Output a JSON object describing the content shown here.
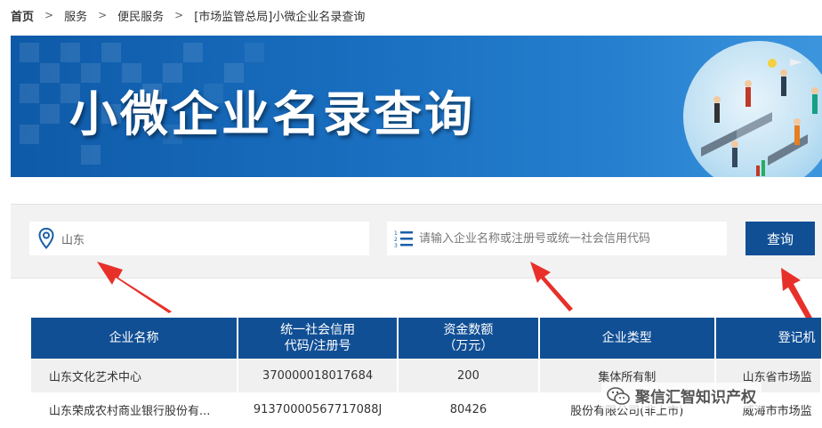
{
  "breadcrumb": {
    "items": [
      "首页",
      "服务",
      "便民服务",
      "[市场监管总局]小微企业名录查询"
    ]
  },
  "banner": {
    "title": "小微企业名录查询"
  },
  "search": {
    "region_value": "山东",
    "keyword_placeholder": "请输入企业名称或注册号或统一社会信用代码",
    "button_label": "查询"
  },
  "table": {
    "headers": [
      "企业名称",
      "统一社会信用代码/注册号",
      "资金数额（万元）",
      "企业类型",
      "登记机关"
    ],
    "header_lines": [
      [
        "企业名称"
      ],
      [
        "统一社会信用",
        "代码/注册号"
      ],
      [
        "资金数额",
        "（万元）"
      ],
      [
        "企业类型"
      ],
      [
        "登记机"
      ]
    ],
    "rows": [
      [
        "山东文化艺术中心",
        "370000018017684",
        "200",
        "集体所有制",
        "山东省市场监"
      ],
      [
        "山东荣成农村商业银行股份有...",
        "91370000567717088J",
        "80426",
        "股份有限公司(非上市)",
        "威海市市场监"
      ]
    ]
  },
  "watermark": {
    "text": "聚信汇智知识产权"
  },
  "colors": {
    "primary": "#114f95",
    "banner": "#1a6fc0",
    "arrow": "#e8302a"
  }
}
